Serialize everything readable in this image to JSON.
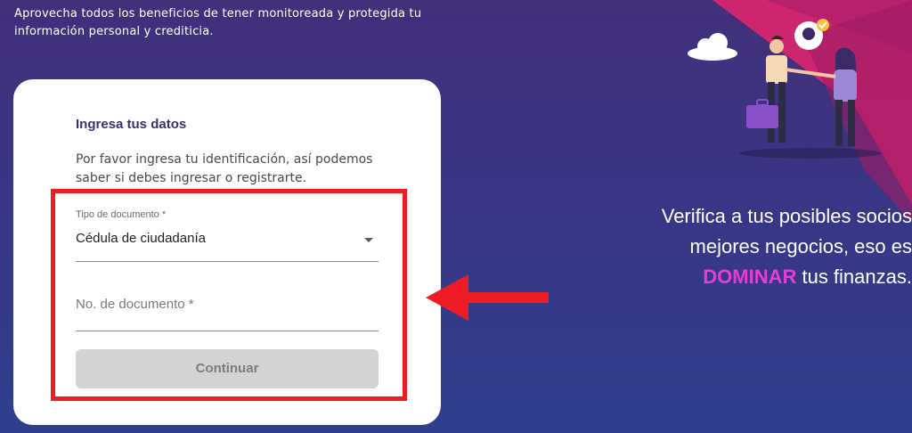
{
  "header": {
    "tagline": "Aprovecha todos los beneficios de tener monitoreada y protegida tu información personal y crediticia."
  },
  "form": {
    "title": "Ingresa tus datos",
    "description": "Por favor ingresa tu identificación, así podemos saber si debes ingresar o registrarte.",
    "doc_type": {
      "label": "Tipo de documento *",
      "value": "Cédula de ciudadanía"
    },
    "doc_number": {
      "label": "No. de documento *"
    },
    "continue_label": "Continuar"
  },
  "promo": {
    "line1": "Verifica a tus posibles socios",
    "line2": "mejores negocios, eso es",
    "accent_word": "DOMINAR",
    "line3_rest": " tus finanzas."
  },
  "icons": [
    "cloud-icon",
    "caret-down-icon",
    "arrow-left-icon",
    "briefcase-icon",
    "checkmark-icon"
  ],
  "colors": {
    "background": "#3a3585",
    "card_title": "#3d2f6f",
    "accent_pink": "#e63cd8",
    "highlight_red": "#ee1c24",
    "button_disabled": "#d3d3d3"
  }
}
